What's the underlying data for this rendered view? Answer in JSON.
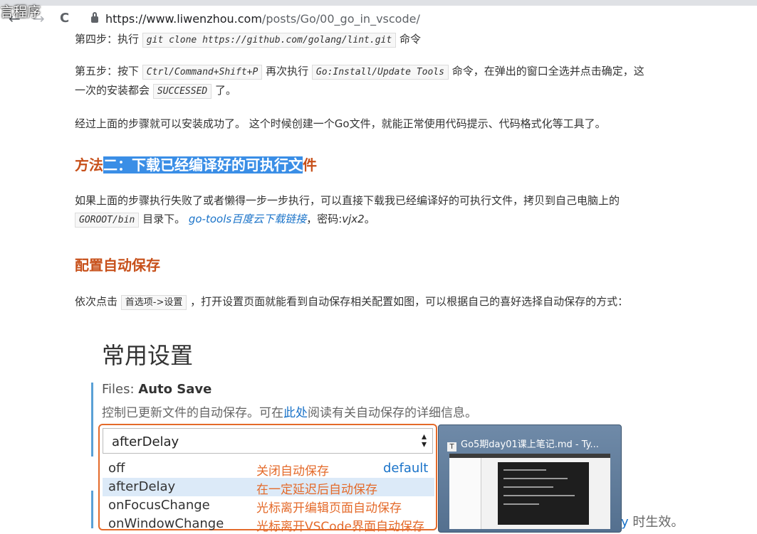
{
  "overlay": {
    "title": "言程序"
  },
  "browser": {
    "back": "←",
    "forward": "→",
    "reload": "C",
    "url_host": "https://www.liwenzhou.com",
    "url_path": "/posts/Go/00_go_in_vscode/"
  },
  "article": {
    "step4": {
      "prefix": "第四步：执行",
      "code": "git clone https://github.com/golang/lint.git",
      "suffix": "命令"
    },
    "step5": {
      "prefix": "第五步：按下",
      "code1": "Ctrl/Command+Shift+P",
      "mid": "再次执行",
      "code2": "Go:Install/Update Tools",
      "suffix": "命令，在弹出的窗口全选并点击确定，这",
      "line2_prefix": "一次的安装都会",
      "code3": "SUCCESSED",
      "line2_suffix": "了。"
    },
    "para_done": "经过上面的步骤就可以安装成功了。 这个时候创建一个Go文件，就能正常使用代码提示、代码格式化等工具了。",
    "heading2": {
      "before": "方法",
      "selected": "二：下载已经编译好的可执行文",
      "after": "件"
    },
    "para_download": {
      "line1": "如果上面的步骤执行失败了或者懒得一步一步执行，可以直接下载我已经编译好的可执行文件，拷贝到自己电脑上的",
      "code": "GOROOT/bin",
      "mid": "目录下。",
      "link": "go-tools百度云下载链接",
      "pwd_label": "，密码:",
      "pwd": "vjx2",
      "end": "。"
    },
    "heading3": "配置自动保存",
    "para_autosave": {
      "prefix": "依次点击",
      "code": "首选项->设置",
      "suffix": "，打开设置页面就能看到自动保存相关配置如图，可以根据自己的喜好选择自动保存的方式："
    }
  },
  "settings_image": {
    "title": "常用设置",
    "label_prefix": "Files: ",
    "label_bold": "Auto Save",
    "desc_prefix": "控制已更新文件的自动保存。可在",
    "desc_link": "此处",
    "desc_suffix": "阅读有关自动保存的详细信息。",
    "selected_value": "afterDelay",
    "arrow_up": "▴",
    "arrow_down": "▾",
    "options": [
      {
        "key": "off",
        "desc": "关闭自动保存",
        "default": "default"
      },
      {
        "key": "afterDelay",
        "desc": "在一定延迟后自动保存",
        "default": ""
      },
      {
        "key": "onFocusChange",
        "desc": "光标离开编辑页面自动保存",
        "default": ""
      },
      {
        "key": "onWindowChange",
        "desc": "光标离开VSCode界面自动保存",
        "default": ""
      }
    ],
    "tail_y": "y",
    "tail_text": " 时生效。"
  },
  "thumbnail": {
    "icon": "T",
    "title": "Go5期day01课上笔记.md - Ty..."
  }
}
